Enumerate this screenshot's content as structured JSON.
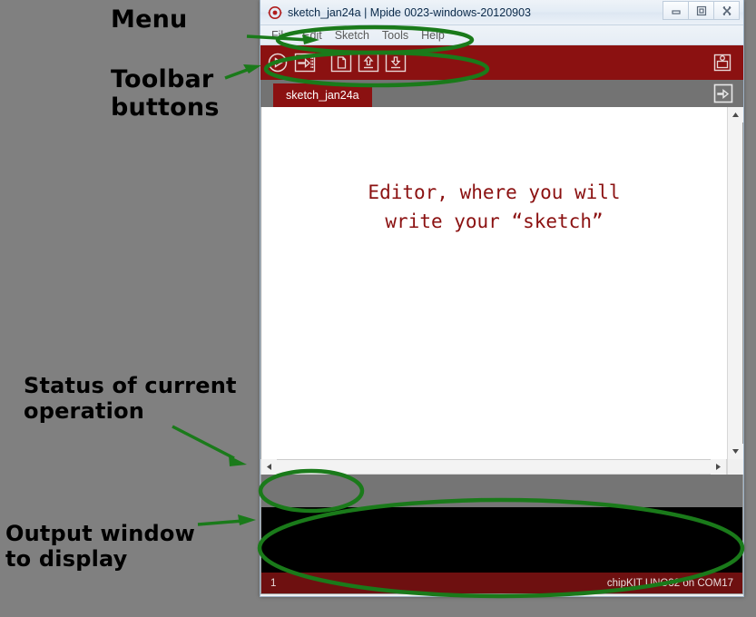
{
  "background_color": "#808080",
  "accent_color": "#8b1111",
  "annotation_color": "#1a7a1a",
  "annotations": [
    {
      "id": "menu",
      "text": "Menu"
    },
    {
      "id": "toolbar",
      "text": "Toolbar\nbuttons"
    },
    {
      "id": "status",
      "text": "Status of current\noperation"
    },
    {
      "id": "output",
      "text": "Output window\nto display"
    }
  ],
  "window": {
    "title": "sketch_jan24a | Mpide 0023-windows-20120903",
    "logo_icon": "mpide-logo-icon",
    "controls": [
      {
        "name": "minimize",
        "icon": "minimize-icon"
      },
      {
        "name": "maximize",
        "icon": "maximize-icon"
      },
      {
        "name": "close",
        "icon": "close-icon"
      }
    ]
  },
  "menubar": {
    "items": [
      {
        "label": "File"
      },
      {
        "label": "Edit"
      },
      {
        "label": "Sketch"
      },
      {
        "label": "Tools"
      },
      {
        "label": "Help"
      }
    ]
  },
  "toolbar": {
    "buttons": [
      {
        "name": "verify-button",
        "icon": "play-circle-icon",
        "tooltip": "Verify"
      },
      {
        "name": "upload-button",
        "icon": "upload-arrow-icon",
        "tooltip": "Upload"
      },
      {
        "name": "new-button",
        "icon": "new-document-icon",
        "tooltip": "New"
      },
      {
        "name": "open-button",
        "icon": "open-up-arrow-icon",
        "tooltip": "Open"
      },
      {
        "name": "save-button",
        "icon": "save-down-arrow-icon",
        "tooltip": "Save"
      }
    ],
    "serial_monitor": {
      "name": "serial-monitor-button",
      "icon": "serial-monitor-icon",
      "tooltip": "Serial Monitor"
    }
  },
  "tabbar": {
    "tabs": [
      {
        "label": "sketch_jan24a",
        "active": true
      }
    ],
    "menu_icon": "tab-menu-arrow-icon"
  },
  "editor": {
    "text": "Editor, where you will\nwrite your “sketch”",
    "text_color": "#8b1111",
    "background": "#ffffff"
  },
  "console": {
    "text": "",
    "background": "#000000"
  },
  "statusbar": {
    "line_number": "1",
    "board_info": "chipKIT UNO32 on COM17"
  }
}
